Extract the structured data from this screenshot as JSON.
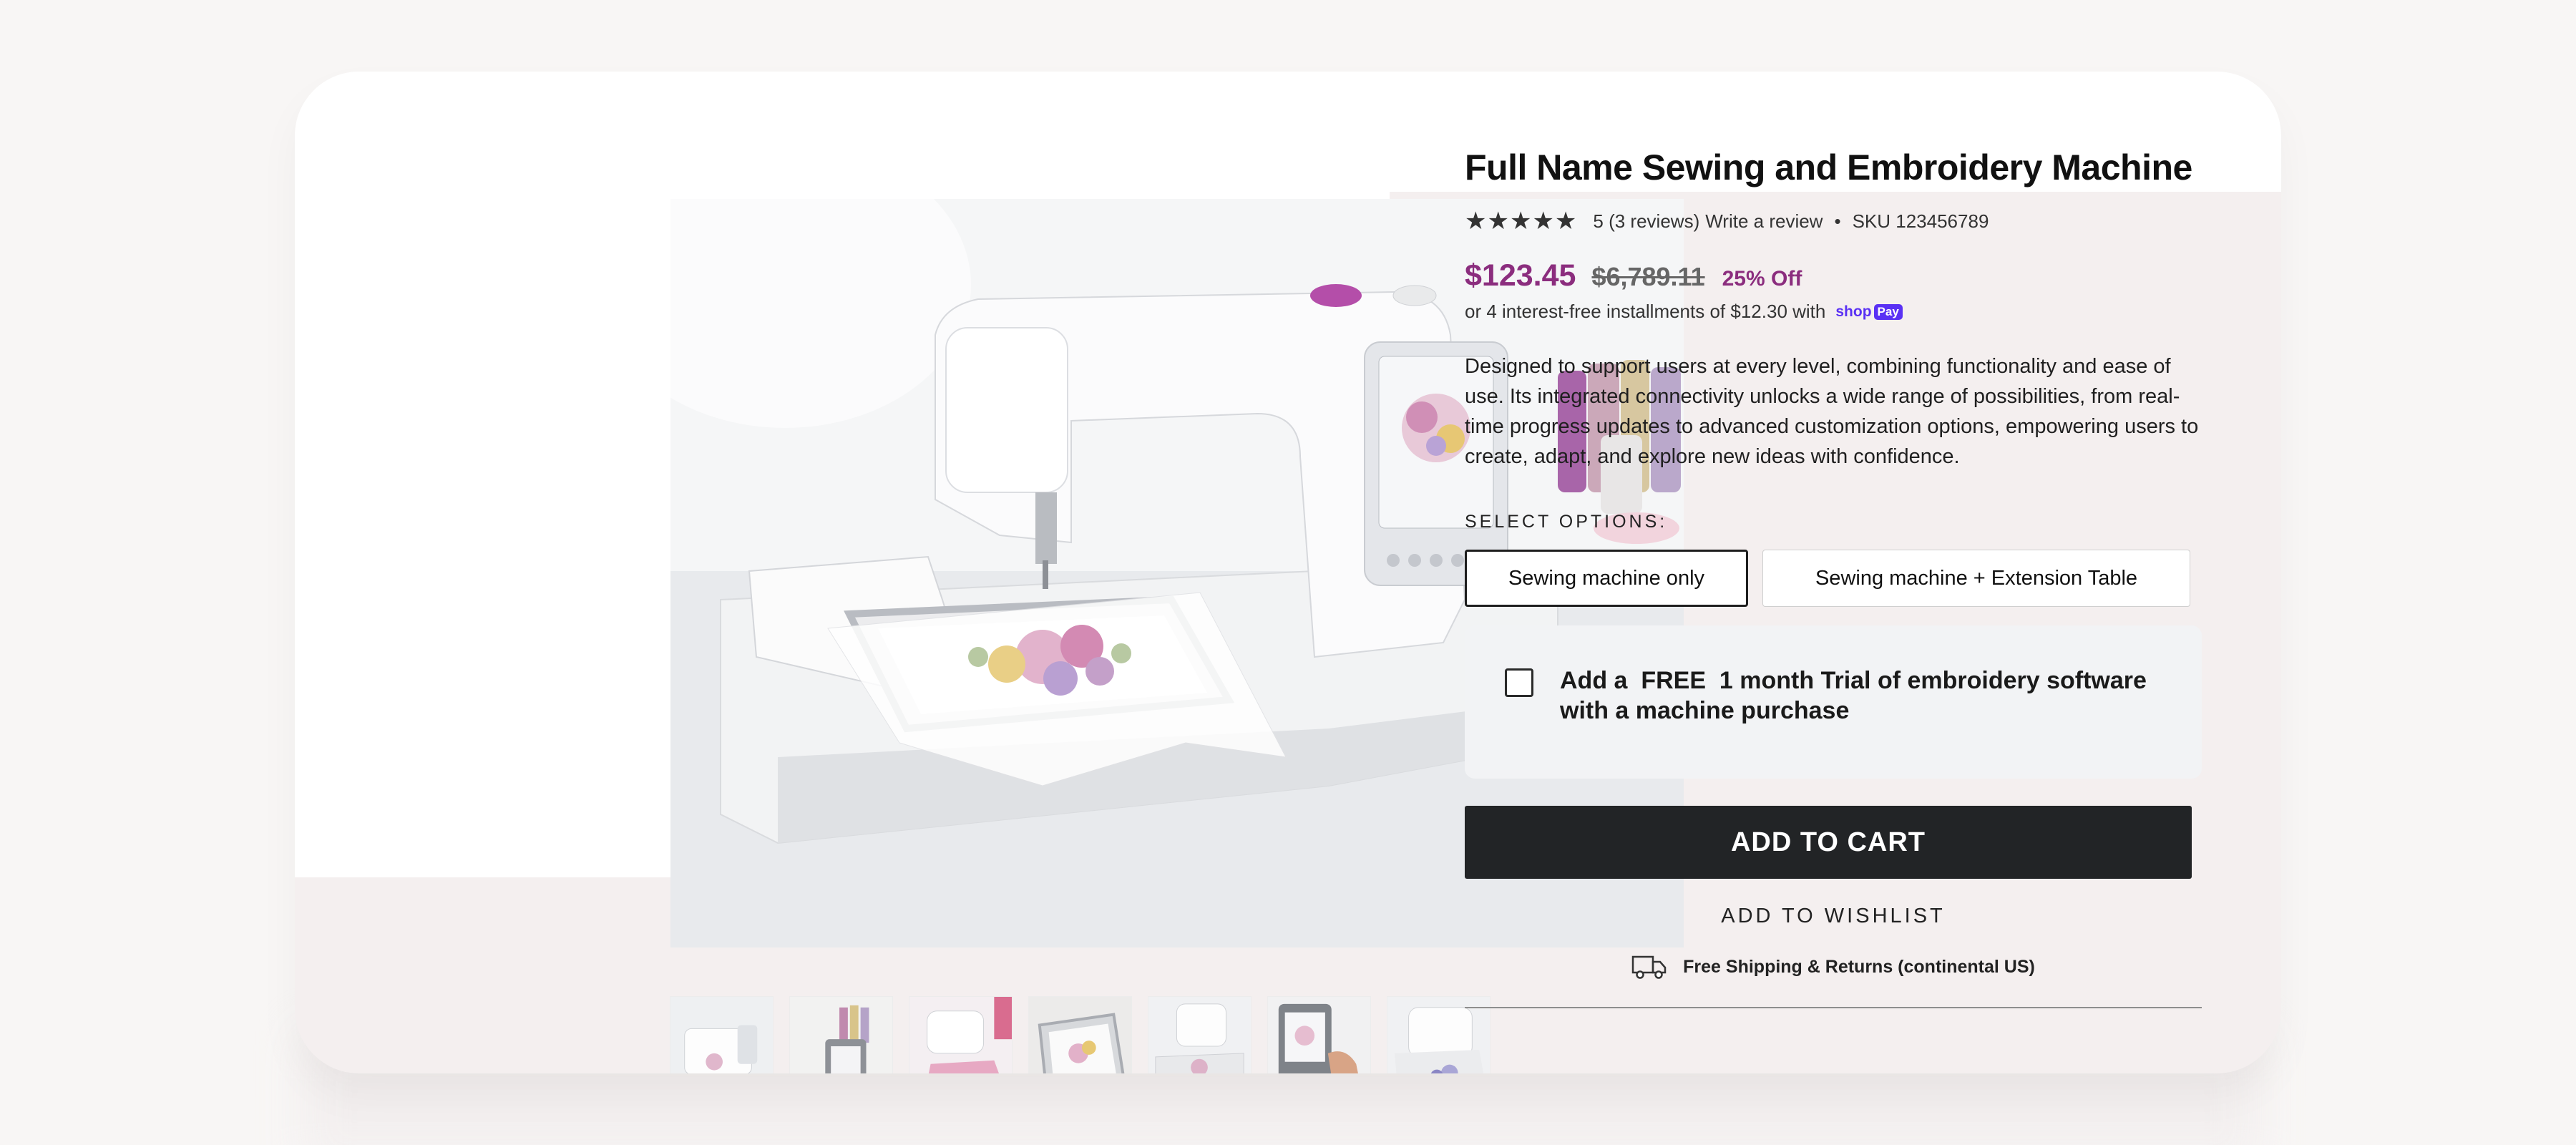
{
  "product": {
    "title": "Full Name Sewing and Embroidery Machine",
    "rating_stars": "★★★★★",
    "rating_text": "5 (3 reviews)",
    "write_review": "Write a review",
    "separator": "•",
    "sku": "SKU 123456789",
    "price": "$123.45",
    "compare_price": "$6,789.11",
    "discount": "25% Off",
    "installments": "or 4 interest-free installments of $12.30 with",
    "shoppay_shop": "shop",
    "shoppay_pay": "Pay",
    "description": "Designed to support users at every level, combining functionality and ease of use. Its integrated connectivity unlocks a wide range of possibilities, from real-time progress updates to advanced customization options, empowering users to create, adapt, and explore new ideas with confidence."
  },
  "options": {
    "label": "SELECT OPTIONS:",
    "items": [
      {
        "label": "Sewing machine only",
        "selected": true
      },
      {
        "label": "Sewing machine + Extension Table",
        "selected": false
      }
    ]
  },
  "trial": {
    "text": "Add a  FREE  1 month Trial of embroidery software with a machine purchase",
    "checked": false
  },
  "actions": {
    "add_to_cart": "ADD TO CART",
    "add_to_wishlist": "ADD TO WISHLIST"
  },
  "shipping": {
    "icon": "truck-icon",
    "text": "Free Shipping & Returns (continental US)"
  },
  "gallery": {
    "thumbnail_count": 7
  },
  "colors": {
    "price": "#8b2d7e",
    "button": "#222426",
    "card_bg": "#f4efef",
    "shoppay": "#5a31f4"
  }
}
